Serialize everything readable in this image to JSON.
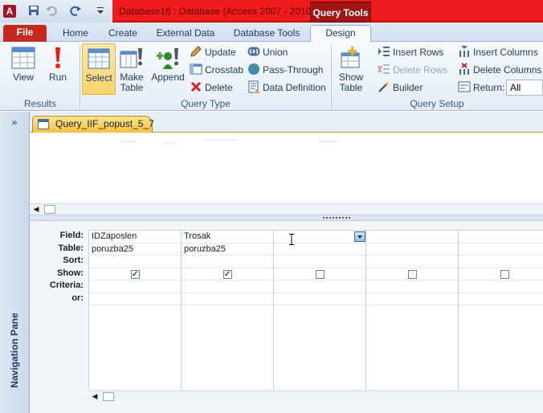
{
  "titlebar": {
    "app_icon": "A",
    "window_title": "Database16 : Database (Access 2007 - 2010)",
    "context_tab": "Query Tools",
    "qat_icons": [
      "save-icon",
      "undo-icon",
      "redo-icon",
      "customize-qat-icon"
    ]
  },
  "tabs": {
    "file": "File",
    "home": "Home",
    "create": "Create",
    "external_data": "External Data",
    "database_tools": "Database Tools",
    "design": "Design"
  },
  "ribbon": {
    "results": {
      "label": "Results",
      "view": "View",
      "run": "Run"
    },
    "query_type": {
      "label": "Query Type",
      "select": "Select",
      "make_table_1": "Make",
      "make_table_2": "Table",
      "append": "Append",
      "update": "Update",
      "crosstab": "Crosstab",
      "delete": "Delete",
      "union": "Union",
      "pass_through": "Pass-Through",
      "data_definition": "Data Definition"
    },
    "query_setup": {
      "label": "Query Setup",
      "show_table_1": "Show",
      "show_table_2": "Table",
      "insert_rows": "Insert Rows",
      "delete_rows": "Delete Rows",
      "builder": "Builder",
      "insert_columns": "Insert Columns",
      "delete_columns": "Delete Columns",
      "return_label": "Return:",
      "return_value": "All"
    }
  },
  "nav": {
    "chevron": "»",
    "label": "Navigation Pane"
  },
  "document": {
    "tab_title": "Query_IIF_popust_5_7"
  },
  "design_grid": {
    "row_labels": [
      "Field:",
      "Table:",
      "Sort:",
      "Show:",
      "Criteria:",
      "or:"
    ],
    "columns": [
      {
        "field": "IDZaposlen",
        "table": "poruzba25",
        "show": true
      },
      {
        "field": "Trosak",
        "table": "poruzba25",
        "show": true
      },
      {
        "field": "",
        "table": "",
        "show": false
      },
      {
        "field": "",
        "table": "",
        "show": false
      },
      {
        "field": "",
        "table": "",
        "show": false
      }
    ]
  },
  "colors": {
    "title_red": "#ee1c1c",
    "context_tab": "#a01515",
    "file_tab": "#c4281f",
    "selected_button": "#f8d46b",
    "doc_tab": "#f5c043"
  }
}
